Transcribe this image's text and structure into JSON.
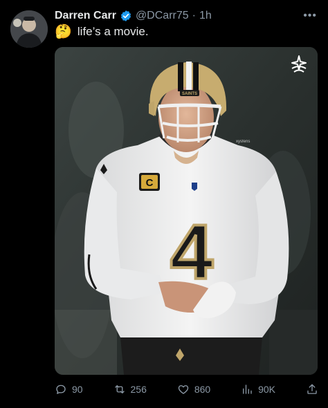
{
  "tweet": {
    "author_name": "Darren Carr",
    "handle": "@DCarr75",
    "separator": "·",
    "time": "1h",
    "text": "life’s a movie.",
    "emoji": "🤔",
    "more_icon": "more-icon"
  },
  "media": {
    "jersey_number": "4",
    "helmet_text": "SAINTS",
    "watermark": "xysfens",
    "badge_icon": "sparkle-badge-icon"
  },
  "actions": {
    "reply_count": "90",
    "retweet_count": "256",
    "like_count": "860",
    "views_count": "90K"
  },
  "colors": {
    "background": "#000000",
    "text": "#e7e9ea",
    "secondary": "#8b98a5",
    "verified": "#1d9bf0",
    "saints_gold": "#bfa56a"
  }
}
